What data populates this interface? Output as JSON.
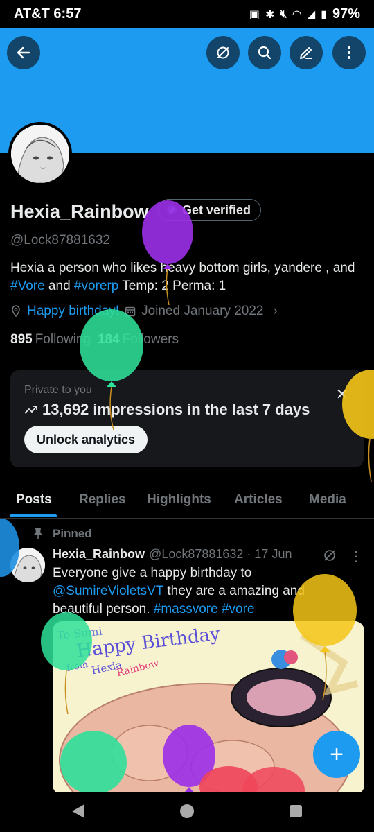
{
  "status_bar": {
    "carrier": "AT&T",
    "time": "6:57",
    "battery": "97%"
  },
  "header": {
    "back_icon": "arrow-left-icon",
    "actions": [
      "grok-icon",
      "search-icon",
      "edit-icon",
      "more-icon"
    ],
    "banner_color": "#1d9bf0"
  },
  "profile": {
    "name": "Hexia_Rainbow",
    "get_verified": "Get verified",
    "handle": "@Lock87881632",
    "bio_prefix": "Hexia a person who likes heavy bottom girls, yandere , and ",
    "bio_tag1": "#Vore",
    "bio_mid": " and ",
    "bio_tag2": "#vorerp",
    "bio_suffix": " Temp: 2 Perma: 1",
    "birthday": "Happy birthday!",
    "joined": "Joined January 2022",
    "following_count": "895",
    "following_label": "Following",
    "followers_count": "184",
    "followers_label": "Followers"
  },
  "analytics": {
    "private_label": "Private to you",
    "impressions": "13,692 impressions in the last 7 days",
    "unlock_label": "Unlock analytics"
  },
  "tabs": [
    "Posts",
    "Replies",
    "Highlights",
    "Articles",
    "Media"
  ],
  "post": {
    "pinned_label": "Pinned",
    "name": "Hexia_Rainbow",
    "handle_date": "@Lock87881632 · 17 Jun",
    "text_line1": "Everyone give a happy birthday to",
    "mention": "@SumireVioletsVT",
    "text_mid": " they are a amazing and beautiful person. ",
    "tag1": "#massvore",
    "tag2": "#vore",
    "image_text": {
      "to": "To Sumi",
      "happy": "Happy Birthday",
      "from": "from",
      "hexia": "Hexia",
      "rainbow": "Rainbow"
    }
  },
  "fab_label": "+",
  "colors": {
    "accent": "#1d9bf0",
    "text": "#e7e9ea",
    "muted": "#71767b",
    "card": "#16181c",
    "balloon_purple": "#9b30e8",
    "balloon_green": "#2fe09a",
    "balloon_yellow": "#f5c518",
    "balloon_blue": "#1d8fe0",
    "balloon_red": "#f0455a"
  }
}
